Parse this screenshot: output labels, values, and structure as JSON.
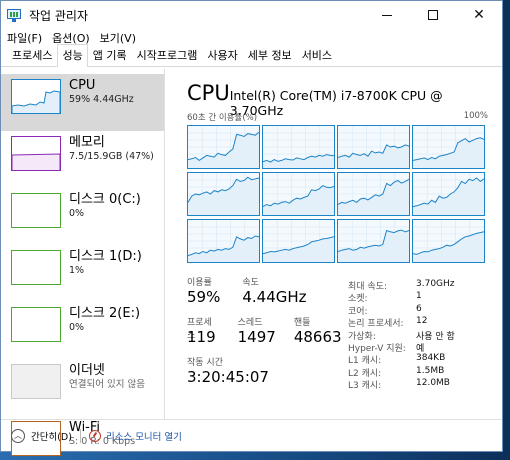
{
  "window": {
    "title": "작업 관리자"
  },
  "menu": [
    "파일(F)",
    "옵션(O)",
    "보기(V)"
  ],
  "tabs": [
    "프로세스",
    "성능",
    "앱 기록",
    "시작프로그램",
    "사용자",
    "세부 정보",
    "서비스"
  ],
  "active_tab": 1,
  "sidebar": [
    {
      "name": "CPU",
      "sub": "59% 4.44GHz",
      "color": "#1b83c9"
    },
    {
      "name": "메모리",
      "sub": "7.5/15.9GB (47%)",
      "color": "#8b2bb3"
    },
    {
      "name": "디스크 0(C:)",
      "sub": "0%",
      "color": "#4ea72e"
    },
    {
      "name": "디스크 1(D:)",
      "sub": "1%",
      "color": "#4ea72e"
    },
    {
      "name": "디스크 2(E:)",
      "sub": "0%",
      "color": "#4ea72e"
    },
    {
      "name": "이더넷",
      "sub": "연결되어 있지 않음",
      "color": "#c9c9c9"
    },
    {
      "name": "Wi-Fi",
      "sub": "S: 0 R: 0 Kbps",
      "color": "#b5651d"
    }
  ],
  "main": {
    "title": "CPU",
    "model": "Intel(R) Core(TM) i7-8700K CPU @ 3.70GHz",
    "util_label": "60초 간 이용률(%)",
    "util_max": "100%"
  },
  "stats": {
    "utilization_label": "이용률",
    "utilization_value": "59%",
    "speed_label": "속도",
    "speed_value": "4.44GHz",
    "processes_label": "프로세스",
    "processes_value": "119",
    "threads_label": "스레드",
    "threads_value": "1497",
    "handles_label": "핸들",
    "handles_value": "48663",
    "uptime_label": "작동 시간",
    "uptime_value": "3:20:45:07"
  },
  "specs": [
    {
      "label": "최대 속도:",
      "value": "3.70GHz"
    },
    {
      "label": "소켓:",
      "value": "1"
    },
    {
      "label": "코어:",
      "value": "6"
    },
    {
      "label": "논리 프로세서:",
      "value": "12"
    },
    {
      "label": "가상화:",
      "value": "사용 안 함"
    },
    {
      "label": "Hyper-V 지원:",
      "value": "예"
    },
    {
      "label": "L1 캐시:",
      "value": "384KB"
    },
    {
      "label": "L2 캐시:",
      "value": "1.5MB"
    },
    {
      "label": "L3 캐시:",
      "value": "12.0MB"
    }
  ],
  "footer": {
    "fewer_details": "간단히(D)",
    "resource_monitor": "리소스 모니터 열기"
  },
  "colors": {
    "cpu_accent": "#1b83c9",
    "cpu_fill": "#e3f0fa"
  },
  "core_usage": [
    [
      20,
      22,
      25,
      18,
      24,
      30,
      28,
      26,
      35,
      32,
      30,
      38,
      45,
      80,
      78,
      75,
      82,
      80,
      78,
      85
    ],
    [
      15,
      18,
      14,
      20,
      16,
      18,
      22,
      20,
      19,
      24,
      22,
      20,
      25,
      28,
      26,
      30,
      28,
      32,
      30,
      29
    ],
    [
      25,
      28,
      30,
      26,
      35,
      32,
      30,
      34,
      28,
      40,
      36,
      38,
      35,
      55,
      50,
      52,
      48,
      50,
      55,
      52
    ],
    [
      18,
      20,
      22,
      24,
      20,
      25,
      22,
      28,
      30,
      32,
      35,
      38,
      60,
      65,
      70,
      62,
      66,
      70,
      72,
      68
    ],
    [
      30,
      45,
      50,
      48,
      52,
      55,
      50,
      58,
      55,
      60,
      58,
      62,
      70,
      85,
      80,
      82,
      90,
      84,
      86,
      88
    ],
    [
      20,
      25,
      22,
      28,
      26,
      30,
      32,
      28,
      35,
      40,
      38,
      42,
      45,
      60,
      58,
      62,
      70,
      66,
      65,
      68
    ],
    [
      25,
      30,
      28,
      32,
      35,
      30,
      38,
      40,
      36,
      42,
      48,
      45,
      50,
      75,
      70,
      78,
      82,
      76,
      80,
      85
    ],
    [
      20,
      22,
      25,
      28,
      26,
      35,
      30,
      45,
      40,
      42,
      50,
      55,
      65,
      80,
      75,
      85,
      82,
      88,
      80,
      86
    ],
    [
      15,
      18,
      22,
      20,
      25,
      22,
      28,
      26,
      30,
      28,
      32,
      30,
      35,
      60,
      55,
      52,
      58,
      56,
      62,
      60
    ],
    [
      20,
      22,
      25,
      24,
      26,
      28,
      30,
      28,
      32,
      34,
      36,
      38,
      42,
      48,
      50,
      52,
      55,
      56,
      58,
      60
    ],
    [
      25,
      28,
      30,
      32,
      28,
      30,
      35,
      33,
      36,
      38,
      40,
      38,
      42,
      75,
      72,
      70,
      74,
      76,
      72,
      75
    ],
    [
      20,
      18,
      22,
      25,
      24,
      28,
      30,
      32,
      35,
      40,
      38,
      42,
      48,
      55,
      60,
      62,
      65,
      68,
      70,
      72
    ]
  ]
}
